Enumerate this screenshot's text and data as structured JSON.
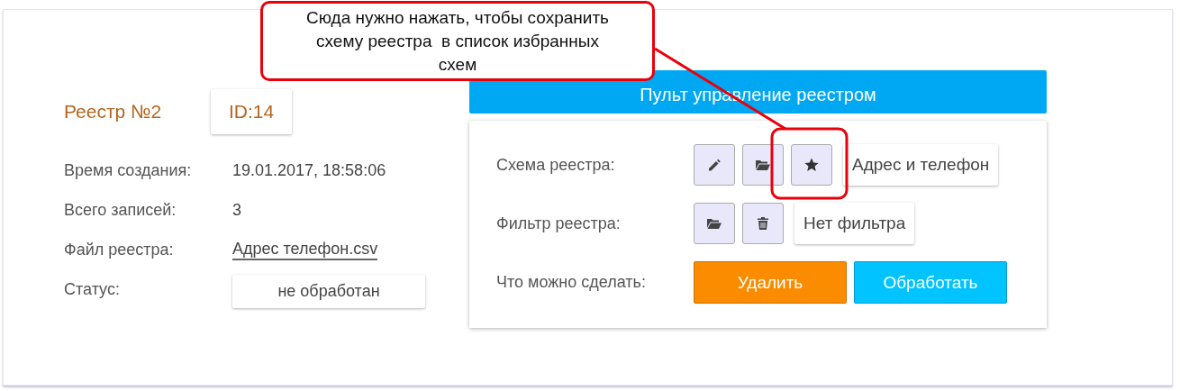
{
  "record": {
    "title": "Реестр №2",
    "id": "ID:14",
    "fields": [
      {
        "label": "Время создания:",
        "value": "19.01.2017, 18:58:06",
        "kind": "text"
      },
      {
        "label": "Всего записей:",
        "value": "3",
        "kind": "text"
      },
      {
        "label": "Файл реестра:",
        "value": "Адрес телефон.csv",
        "kind": "link"
      },
      {
        "label": "Статус:",
        "value": "не обработан",
        "kind": "badge"
      }
    ]
  },
  "control_panel": {
    "title": "Пульт управление реестром",
    "rows": [
      {
        "label": "Схема реестра:",
        "items": [
          {
            "kind": "pencil"
          },
          {
            "kind": "folder"
          },
          {
            "kind": "star"
          },
          {
            "kind": "label",
            "text": "Адрес и телефон"
          }
        ]
      },
      {
        "label": "Фильтр реестра:",
        "items": [
          {
            "kind": "folder"
          },
          {
            "kind": "trash"
          },
          {
            "kind": "label",
            "text": "Нет фильтра"
          }
        ]
      },
      {
        "label": "Что можно сделать:",
        "items": [
          {
            "kind": "action",
            "text": "Удалить",
            "color": "#fb8c00"
          },
          {
            "kind": "action",
            "text": "Обработать",
            "color": "#00c3ff"
          }
        ]
      }
    ]
  },
  "annotation": {
    "text": "Сюда нужно нажать, чтобы сохранить\nсхему реестра  в список избранных\nсхем"
  }
}
